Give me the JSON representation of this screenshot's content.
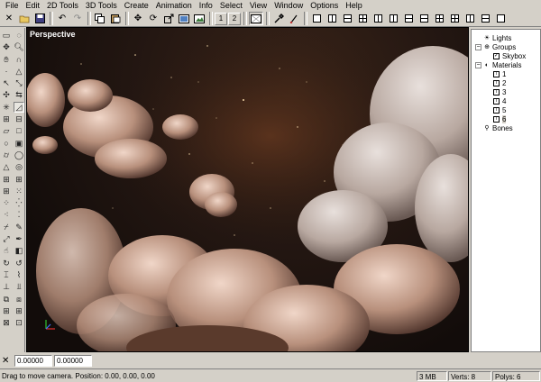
{
  "menubar": {
    "items": [
      "File",
      "Edit",
      "2D Tools",
      "3D Tools",
      "Create",
      "Animation",
      "Info",
      "Select",
      "View",
      "Window",
      "Options",
      "Help"
    ]
  },
  "toolbar": {
    "icons": [
      "close-icon",
      "open-folder-icon",
      "save-icon",
      "undo-icon",
      "redo-icon",
      "copy-icon",
      "paste-icon",
      "move-icon",
      "rotate-icon",
      "scale-icon",
      "view-icon",
      "icon-tool"
    ],
    "layout_buttons": [
      "1",
      "2"
    ]
  },
  "viewport": {
    "title": "Perspective"
  },
  "scene_tree": {
    "nodes": [
      {
        "label": "Lights",
        "icon": "light-icon"
      },
      {
        "label": "Groups",
        "icon": "group-icon"
      },
      {
        "label": "Skybox",
        "icon": "checkbox-icon",
        "checked": true
      },
      {
        "label": "Materials",
        "icon": "material-icon"
      },
      {
        "label": "1"
      },
      {
        "label": "2"
      },
      {
        "label": "3"
      },
      {
        "label": "4"
      },
      {
        "label": "5"
      },
      {
        "label": "6",
        "selected": true
      },
      {
        "label": "Bones",
        "icon": "bone-icon"
      }
    ]
  },
  "coords": {
    "x_value": "0.00000",
    "y_value": "0.00000"
  },
  "statusbar": {
    "message": "Drag to move camera. Position: 0.00, 0.00, 0.00",
    "memory": "3 MB",
    "verts": "Verts: 8",
    "polys": "Polys: 6"
  },
  "colors": {
    "chrome": "#d4d0c8",
    "viewport_bg": "#1a110d",
    "cloud": "#d9b8a5"
  }
}
